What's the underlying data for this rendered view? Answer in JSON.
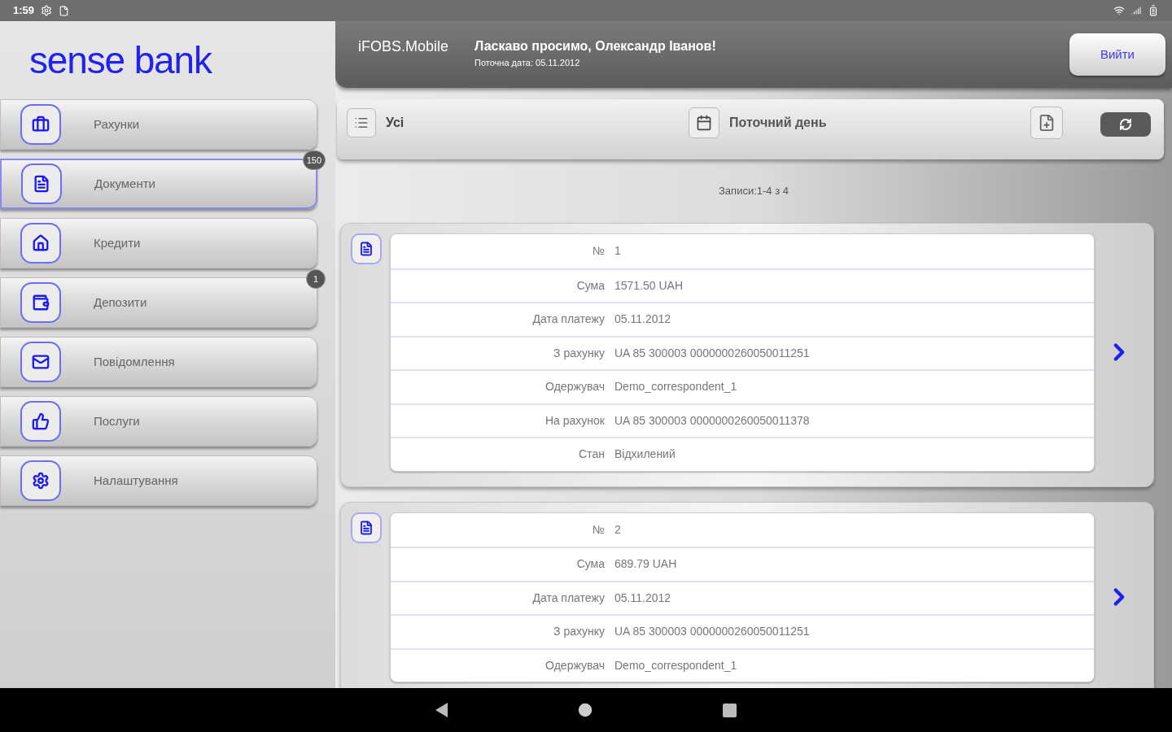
{
  "status_bar": {
    "time": "1:59"
  },
  "logo": {
    "text": "sense bank"
  },
  "header": {
    "app_name": "iFOBS.Mobile",
    "greeting": "Ласкаво просимо, Олександр Іванов!",
    "current_date": "Поточна дата: 05.11.2012",
    "logout": "Вийти"
  },
  "sidebar": {
    "items": [
      {
        "label": "Рахунки",
        "kind": "accounts",
        "selected": false
      },
      {
        "label": "Документи",
        "kind": "documents",
        "selected": true,
        "badge": "150"
      },
      {
        "label": "Кредити",
        "kind": "credits",
        "selected": false
      },
      {
        "label": "Депозити",
        "kind": "deposits",
        "selected": false,
        "badge": "1"
      },
      {
        "label": "Повідомлення",
        "kind": "messages",
        "selected": false
      },
      {
        "label": "Послуги",
        "kind": "services",
        "selected": false
      },
      {
        "label": "Налаштування",
        "kind": "settings",
        "selected": false
      }
    ]
  },
  "filters": {
    "type": "Усі",
    "period": "Поточний день"
  },
  "records": "Записи:1-4 з 4",
  "documents": [
    {
      "rows": [
        {
          "label": "№",
          "value": "1"
        },
        {
          "label": "Сума",
          "value": "1571.50 UAH"
        },
        {
          "label": "Дата платежу",
          "value": "05.11.2012"
        },
        {
          "label": "З рахунку",
          "value": "UA 85 300003 0000000260050011251"
        },
        {
          "label": "Одержувач",
          "value": "Demo_correspondent_1"
        },
        {
          "label": "На рахунок",
          "value": "UA 85 300003 0000000260050011378"
        },
        {
          "label": "Стан",
          "value": "Відхилений"
        }
      ]
    },
    {
      "rows": [
        {
          "label": "№",
          "value": "2"
        },
        {
          "label": "Сума",
          "value": "689.79 UAH"
        },
        {
          "label": "Дата платежу",
          "value": "05.11.2012"
        },
        {
          "label": "З рахунку",
          "value": "UA 85 300003 0000000260050011251"
        },
        {
          "label": "Одержувач",
          "value": "Demo_correspondent_1"
        }
      ]
    }
  ]
}
